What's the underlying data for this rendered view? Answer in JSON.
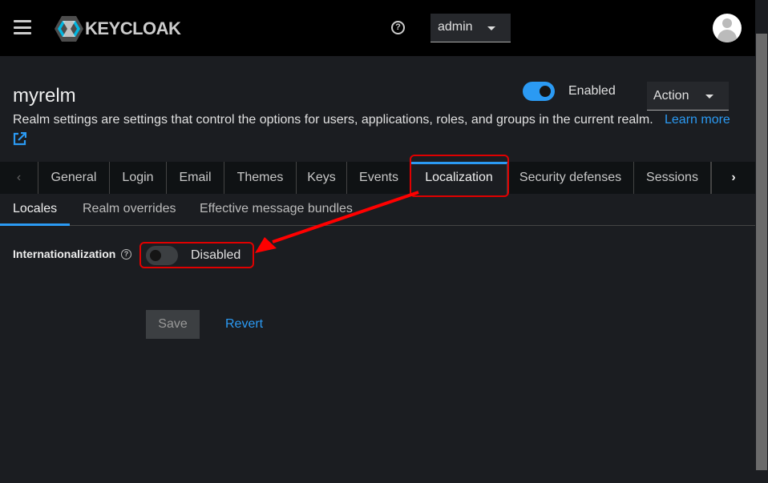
{
  "header": {
    "brand": "KEYCLOAK",
    "user": "admin"
  },
  "realm": {
    "name": "myrelm",
    "description": "Realm settings are settings that control the options for users, applications, roles, and groups in the current realm.",
    "learn_more": "Learn more",
    "enabled_label": "Enabled",
    "enabled": true,
    "action_label": "Action"
  },
  "tabs": [
    "General",
    "Login",
    "Email",
    "Themes",
    "Keys",
    "Events",
    "Localization",
    "Security defenses",
    "Sessions"
  ],
  "active_tab": "Localization",
  "subtabs": [
    "Locales",
    "Realm overrides",
    "Effective message bundles"
  ],
  "form": {
    "internationalization_label": "Internationalization",
    "internationalization_state": "Disabled",
    "internationalization_enabled": false,
    "save": "Save",
    "revert": "Revert"
  },
  "colors": {
    "accent": "#2b9af3",
    "annotation": "#e00000"
  }
}
